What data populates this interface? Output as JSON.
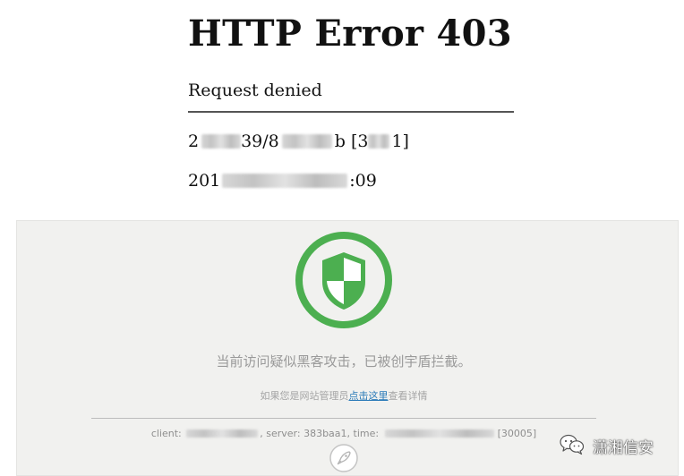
{
  "error": {
    "title": "HTTP Error 403",
    "subtitle": "Request denied",
    "request_line": {
      "part1": "2",
      "part2": "39/8",
      "part3": "b [3",
      "part4": "1]"
    },
    "time_line": {
      "prefix": "201",
      "suffix": ":09"
    }
  },
  "notice": {
    "message": "当前访问疑似黑客攻击，已被创宇盾拦截。",
    "admin_prefix": "如果您是网站管理员",
    "admin_link": "点击这里",
    "admin_suffix": "查看详情",
    "info_client_label": "client: ",
    "info_server": ", server: 383baa1, time: ",
    "info_code": "[30005]"
  },
  "watermark": {
    "text": "潇湘信安"
  },
  "colors": {
    "shield_green": "#4caf50",
    "panel_bg": "#f1f1ef",
    "link_blue": "#2a7ab8"
  }
}
